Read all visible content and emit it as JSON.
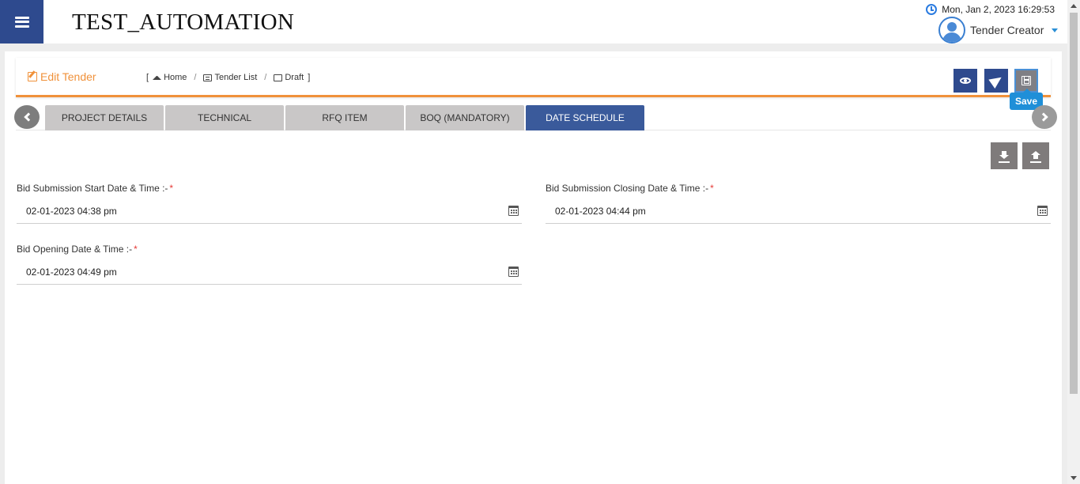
{
  "header": {
    "app_title": "TEST_AUTOMATION",
    "datetime": "Mon, Jan 2, 2023 16:29:53",
    "user_name": "Tender Creator"
  },
  "page": {
    "title": "Edit Tender",
    "breadcrumb": {
      "open": "[",
      "close": "]",
      "separator": "/",
      "items": [
        "Home",
        "Tender List",
        "Draft"
      ]
    }
  },
  "actions": {
    "save_tooltip": "Save"
  },
  "tabs": [
    {
      "label": "PROJECT DETAILS",
      "active": false
    },
    {
      "label": "TECHNICAL",
      "active": false
    },
    {
      "label": "RFQ ITEM",
      "active": false
    },
    {
      "label": "BOQ (MANDATORY)",
      "active": false
    },
    {
      "label": "DATE SCHEDULE",
      "active": true
    }
  ],
  "form": {
    "required_mark": "*",
    "bid_start": {
      "label": "Bid Submission Start Date & Time :-",
      "value": "02-01-2023 04:38 pm"
    },
    "bid_close": {
      "label": "Bid Submission Closing Date & Time :-",
      "value": "02-01-2023 04:44 pm"
    },
    "bid_open": {
      "label": "Bid Opening Date & Time :-",
      "value": "02-01-2023 04:49 pm"
    }
  },
  "colors": {
    "primary": "#2e4a8e",
    "accent": "#f0913a",
    "tab_active": "#3a5a9b",
    "tooltip": "#1f8fd8"
  },
  "icons": [
    "menu-icon",
    "clock-icon",
    "user-avatar-icon",
    "caret-down-icon",
    "edit-icon",
    "home-icon",
    "list-icon",
    "draft-edit-icon",
    "eye-icon",
    "send-icon",
    "save-disk-icon",
    "chevron-left-icon",
    "chevron-right-icon",
    "download-icon",
    "upload-icon",
    "calendar-icon"
  ]
}
